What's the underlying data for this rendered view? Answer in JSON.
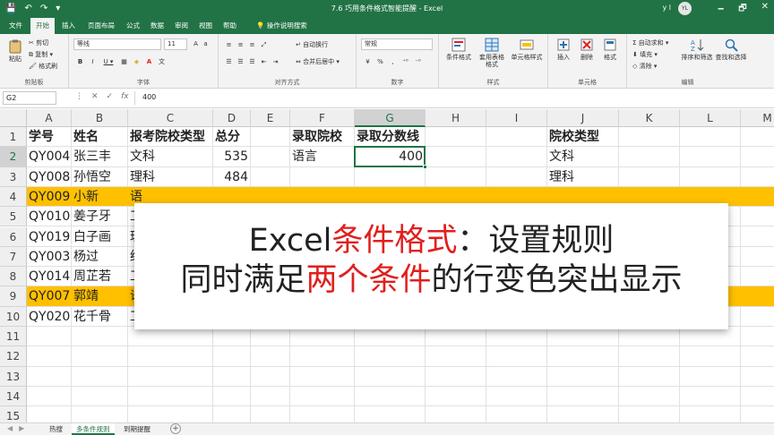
{
  "app": {
    "title": "7.6 巧用条件格式智能提醒 - Excel",
    "user": "y l",
    "avatar": "YL",
    "quick_access": [
      "💾",
      "↶",
      "↷",
      "▾"
    ],
    "window_controls": [
      "🗕",
      "🗗",
      "✕"
    ]
  },
  "tabs": [
    "文件",
    "开始",
    "插入",
    "页面布局",
    "公式",
    "数据",
    "审阅",
    "视图",
    "帮助",
    "操作说明搜索"
  ],
  "active_tab": "开始",
  "ribbon": {
    "clipboard": {
      "label": "剪贴板",
      "paste": "粘贴",
      "cut": "剪切",
      "copy": "复制 ▾",
      "format_painter": "格式刷"
    },
    "font": {
      "label": "字体",
      "name": "等线",
      "size": "11",
      "bold": "B",
      "italic": "I",
      "underline": "U ▾"
    },
    "alignment": {
      "label": "对齐方式",
      "wrap": "自动换行",
      "merge": "合并后居中 ▾"
    },
    "number": {
      "label": "数字",
      "format": "常规",
      "percent": "%",
      "comma": ","
    },
    "styles": {
      "label": "样式",
      "conditional": "条件格式",
      "table": "套用表格格式",
      "cell_styles": "单元格样式"
    },
    "cells": {
      "label": "单元格",
      "insert": "插入",
      "delete": "删除",
      "format": "格式"
    },
    "editing": {
      "label": "编辑",
      "autosum": "自动求和 ▾",
      "fill": "填充 ▾",
      "clear": "清除 ▾",
      "sort": "排序和筛选",
      "find": "查找和选择"
    }
  },
  "formula_bar": {
    "name_box": "G2",
    "value": "400",
    "icons": [
      "⋮",
      "✕",
      "✓",
      "fx"
    ]
  },
  "columns": [
    "A",
    "B",
    "C",
    "D",
    "E",
    "F",
    "G",
    "H",
    "I",
    "J",
    "K",
    "L",
    "M"
  ],
  "selected_column": "G",
  "rows": [
    "1",
    "2",
    "3",
    "4",
    "5",
    "6",
    "7",
    "8",
    "9",
    "10",
    "11",
    "12",
    "13",
    "14",
    "15"
  ],
  "selected_row": "2",
  "cells": {
    "A1": "学号",
    "B1": "姓名",
    "C1": "报考院校类型",
    "D1": "总分",
    "F1": "录取院校",
    "G1": "录取分数线",
    "J1": "院校类型",
    "A2": "QY004",
    "B2": "张三丰",
    "C2": "文科",
    "D2": "535",
    "F2": "语言",
    "G2": "400",
    "J2": "文科",
    "A3": "QY008",
    "B3": "孙悟空",
    "C3": "理科",
    "D3": "484",
    "J3": "理科",
    "A4": "QY009",
    "B4": "小新",
    "C4": "语",
    "A5": "QY010",
    "B5": "姜子牙",
    "C5": "工",
    "A6": "QY019",
    "B6": "白子画",
    "C6": "理",
    "A7": "QY003",
    "B7": "杨过",
    "C7": "经",
    "A8": "QY014",
    "B8": "周芷若",
    "C8": "工",
    "A9": "QY007",
    "B9": "郭靖",
    "C9": "语",
    "A10": "QY020",
    "B10": "花千骨",
    "C10": "工"
  },
  "highlight_rows": [
    "4",
    "9"
  ],
  "highlight_color": "#ffc000",
  "accent": "#217346",
  "sheets": [
    "热搜",
    "多条件规则",
    "到期提醒"
  ],
  "active_sheet": "多条件规则",
  "overlay": {
    "line1_a": "Excel",
    "line1_b": "条件格式",
    "line1_c": "：设置规则",
    "line2_a": "同时满足",
    "line2_b": "两个条件",
    "line2_c": "的行变色突出显示",
    "accent": "#e0201e"
  }
}
